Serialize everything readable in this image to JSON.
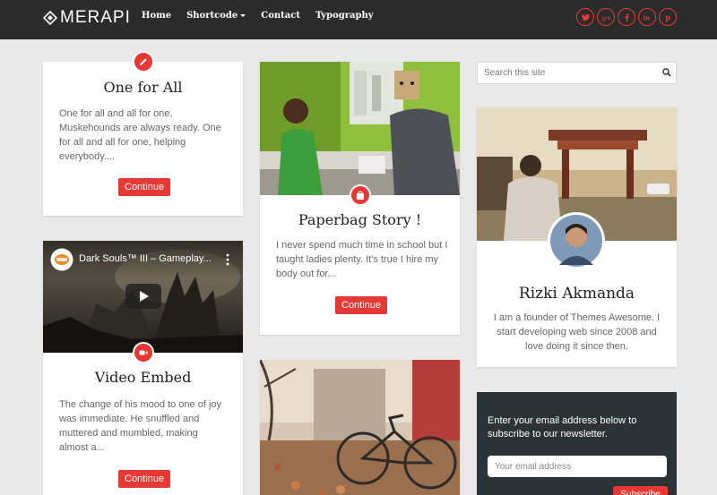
{
  "header": {
    "logo": "MERAPI",
    "nav": [
      "Home",
      "Shortcode",
      "Contact",
      "Typography"
    ],
    "social": [
      "twitter-icon",
      "google-plus-icon",
      "facebook-icon",
      "linkedin-icon",
      "pinterest-icon"
    ]
  },
  "posts": [
    {
      "title": "One for All",
      "excerpt": "One for all and all for one, Muskehounds are always ready. One for all and all for one, helping everybody....",
      "button": "Continue",
      "badge_icon": "pencil-icon"
    },
    {
      "title": "Video Embed",
      "video_title": "Dark Souls™ III – Gameplay...",
      "excerpt": "The change of his mood to one of joy was immediate. He snuffled and muttered and mumbled, making almost a...",
      "button": "Continue",
      "badge_icon": "video-camera-icon"
    },
    {
      "title": "Paperbag Story !",
      "excerpt": "I never spend much time in school but I taught ladies plenty. It's true I hire my body out for...",
      "button": "Continue",
      "badge_icon": "shopping-bag-icon"
    }
  ],
  "sidebar": {
    "search_placeholder": "Search this site",
    "profile": {
      "name": "Rizki Akmanda",
      "bio": "I am a founder of Themes Awesome. I start developing web since 2008 and love doing it since then."
    },
    "newsletter": {
      "text": "Enter your email address below to subscribe to our newsletter.",
      "placeholder": "Your email address",
      "button": "Subscribe"
    }
  },
  "colors": {
    "accent": "#e53935",
    "topbar": "#2b2b2b",
    "background": "#e9e9e9",
    "newsletter_bg": "#2c3337"
  }
}
